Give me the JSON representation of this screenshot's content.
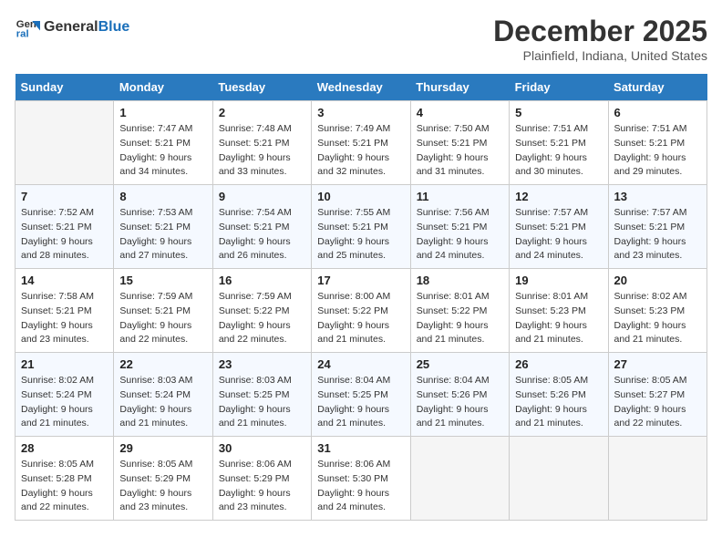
{
  "header": {
    "logo_general": "General",
    "logo_blue": "Blue",
    "month_year": "December 2025",
    "location": "Plainfield, Indiana, United States"
  },
  "weekdays": [
    "Sunday",
    "Monday",
    "Tuesday",
    "Wednesday",
    "Thursday",
    "Friday",
    "Saturday"
  ],
  "weeks": [
    [
      {
        "day": "",
        "sunrise": "",
        "sunset": "",
        "daylight": ""
      },
      {
        "day": "1",
        "sunrise": "7:47 AM",
        "sunset": "5:21 PM",
        "daylight": "9 hours and 34 minutes."
      },
      {
        "day": "2",
        "sunrise": "7:48 AM",
        "sunset": "5:21 PM",
        "daylight": "9 hours and 33 minutes."
      },
      {
        "day": "3",
        "sunrise": "7:49 AM",
        "sunset": "5:21 PM",
        "daylight": "9 hours and 32 minutes."
      },
      {
        "day": "4",
        "sunrise": "7:50 AM",
        "sunset": "5:21 PM",
        "daylight": "9 hours and 31 minutes."
      },
      {
        "day": "5",
        "sunrise": "7:51 AM",
        "sunset": "5:21 PM",
        "daylight": "9 hours and 30 minutes."
      },
      {
        "day": "6",
        "sunrise": "7:51 AM",
        "sunset": "5:21 PM",
        "daylight": "9 hours and 29 minutes."
      }
    ],
    [
      {
        "day": "7",
        "sunrise": "7:52 AM",
        "sunset": "5:21 PM",
        "daylight": "9 hours and 28 minutes."
      },
      {
        "day": "8",
        "sunrise": "7:53 AM",
        "sunset": "5:21 PM",
        "daylight": "9 hours and 27 minutes."
      },
      {
        "day": "9",
        "sunrise": "7:54 AM",
        "sunset": "5:21 PM",
        "daylight": "9 hours and 26 minutes."
      },
      {
        "day": "10",
        "sunrise": "7:55 AM",
        "sunset": "5:21 PM",
        "daylight": "9 hours and 25 minutes."
      },
      {
        "day": "11",
        "sunrise": "7:56 AM",
        "sunset": "5:21 PM",
        "daylight": "9 hours and 24 minutes."
      },
      {
        "day": "12",
        "sunrise": "7:57 AM",
        "sunset": "5:21 PM",
        "daylight": "9 hours and 24 minutes."
      },
      {
        "day": "13",
        "sunrise": "7:57 AM",
        "sunset": "5:21 PM",
        "daylight": "9 hours and 23 minutes."
      }
    ],
    [
      {
        "day": "14",
        "sunrise": "7:58 AM",
        "sunset": "5:21 PM",
        "daylight": "9 hours and 23 minutes."
      },
      {
        "day": "15",
        "sunrise": "7:59 AM",
        "sunset": "5:21 PM",
        "daylight": "9 hours and 22 minutes."
      },
      {
        "day": "16",
        "sunrise": "7:59 AM",
        "sunset": "5:22 PM",
        "daylight": "9 hours and 22 minutes."
      },
      {
        "day": "17",
        "sunrise": "8:00 AM",
        "sunset": "5:22 PM",
        "daylight": "9 hours and 21 minutes."
      },
      {
        "day": "18",
        "sunrise": "8:01 AM",
        "sunset": "5:22 PM",
        "daylight": "9 hours and 21 minutes."
      },
      {
        "day": "19",
        "sunrise": "8:01 AM",
        "sunset": "5:23 PM",
        "daylight": "9 hours and 21 minutes."
      },
      {
        "day": "20",
        "sunrise": "8:02 AM",
        "sunset": "5:23 PM",
        "daylight": "9 hours and 21 minutes."
      }
    ],
    [
      {
        "day": "21",
        "sunrise": "8:02 AM",
        "sunset": "5:24 PM",
        "daylight": "9 hours and 21 minutes."
      },
      {
        "day": "22",
        "sunrise": "8:03 AM",
        "sunset": "5:24 PM",
        "daylight": "9 hours and 21 minutes."
      },
      {
        "day": "23",
        "sunrise": "8:03 AM",
        "sunset": "5:25 PM",
        "daylight": "9 hours and 21 minutes."
      },
      {
        "day": "24",
        "sunrise": "8:04 AM",
        "sunset": "5:25 PM",
        "daylight": "9 hours and 21 minutes."
      },
      {
        "day": "25",
        "sunrise": "8:04 AM",
        "sunset": "5:26 PM",
        "daylight": "9 hours and 21 minutes."
      },
      {
        "day": "26",
        "sunrise": "8:05 AM",
        "sunset": "5:26 PM",
        "daylight": "9 hours and 21 minutes."
      },
      {
        "day": "27",
        "sunrise": "8:05 AM",
        "sunset": "5:27 PM",
        "daylight": "9 hours and 22 minutes."
      }
    ],
    [
      {
        "day": "28",
        "sunrise": "8:05 AM",
        "sunset": "5:28 PM",
        "daylight": "9 hours and 22 minutes."
      },
      {
        "day": "29",
        "sunrise": "8:05 AM",
        "sunset": "5:29 PM",
        "daylight": "9 hours and 23 minutes."
      },
      {
        "day": "30",
        "sunrise": "8:06 AM",
        "sunset": "5:29 PM",
        "daylight": "9 hours and 23 minutes."
      },
      {
        "day": "31",
        "sunrise": "8:06 AM",
        "sunset": "5:30 PM",
        "daylight": "9 hours and 24 minutes."
      },
      {
        "day": "",
        "sunrise": "",
        "sunset": "",
        "daylight": ""
      },
      {
        "day": "",
        "sunrise": "",
        "sunset": "",
        "daylight": ""
      },
      {
        "day": "",
        "sunrise": "",
        "sunset": "",
        "daylight": ""
      }
    ]
  ],
  "labels": {
    "sunrise_prefix": "Sunrise: ",
    "sunset_prefix": "Sunset: ",
    "daylight_prefix": "Daylight: "
  }
}
